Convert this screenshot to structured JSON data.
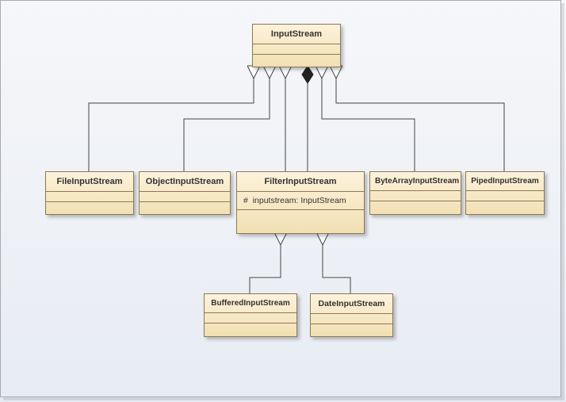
{
  "diagram": {
    "root": "InputStream",
    "classes": {
      "inputstream": "InputStream",
      "fileinputstream": "FileInputStream",
      "objectinputstream": "ObjectInputStream",
      "filterinputstream": "FilterInputStream",
      "bytearrayinputstream": "ByteArrayInputStream",
      "pipedinputstream": "PipedInputStream",
      "bufferedinputstream": "BufferedInputStream",
      "dateinputstream": "DateInputStream"
    },
    "filter_attr": {
      "visibility": "#",
      "text": "inputstream: InputStream"
    },
    "relations": [
      {
        "from": "FileInputStream",
        "to": "InputStream",
        "type": "generalization"
      },
      {
        "from": "ObjectInputStream",
        "to": "InputStream",
        "type": "generalization"
      },
      {
        "from": "FilterInputStream",
        "to": "InputStream",
        "type": "generalization"
      },
      {
        "from": "ByteArrayInputStream",
        "to": "InputStream",
        "type": "generalization"
      },
      {
        "from": "PipedInputStream",
        "to": "InputStream",
        "type": "generalization"
      },
      {
        "from": "FilterInputStream",
        "to": "InputStream",
        "type": "composition"
      },
      {
        "from": "BufferedInputStream",
        "to": "FilterInputStream",
        "type": "generalization"
      },
      {
        "from": "DateInputStream",
        "to": "FilterInputStream",
        "type": "generalization"
      }
    ]
  }
}
